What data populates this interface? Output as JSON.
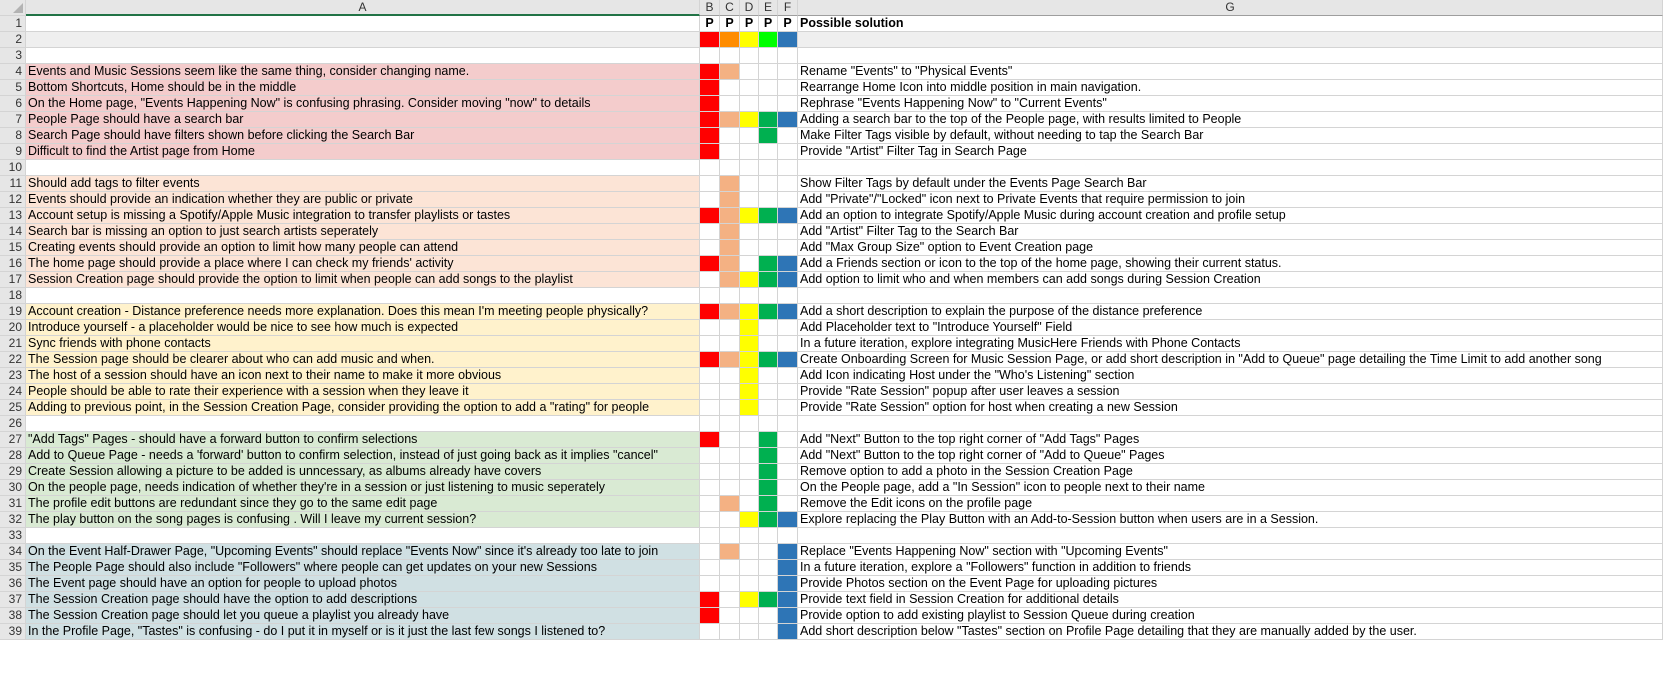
{
  "colors": {
    "red": "#ff0000",
    "orange": "#ff8c00",
    "salmon": "#f4b183",
    "yellow": "#ffff00",
    "lightgreen": "#00ff00",
    "green": "#00b050",
    "blue": "#2e75b6",
    "pink": "#f4cccc",
    "peach": "#fce4d6",
    "cream": "#fff2cc",
    "mint": "#d9ead3",
    "lightblue": "#d0e0e3",
    "gray": "#efefef"
  },
  "column_headers": [
    "A",
    "B",
    "C",
    "D",
    "E",
    "F",
    "G"
  ],
  "rows": [
    {
      "n": "1",
      "a": "",
      "bg": "",
      "m": [
        "",
        "",
        "",
        "",
        ""
      ],
      "p": [
        "P",
        "P",
        "P",
        "P",
        "P"
      ],
      "g": "Possible solution",
      "gbold": true
    },
    {
      "n": "2",
      "a": "",
      "bg": "gray",
      "m": [
        "red",
        "orange",
        "yellow",
        "lightgreen",
        "blue"
      ],
      "p": [
        "",
        "",
        "",
        "",
        ""
      ],
      "g": "",
      "gbg": "gray"
    },
    {
      "n": "3",
      "a": "",
      "bg": "",
      "m": [
        "",
        "",
        "",
        "",
        ""
      ],
      "p": [
        "",
        "",
        "",
        "",
        ""
      ],
      "g": ""
    },
    {
      "n": "4",
      "a": "Events and Music Sessions seem like the same thing, consider changing name.",
      "bg": "pink",
      "m": [
        "red",
        "salmon",
        "",
        "",
        ""
      ],
      "p": [
        "",
        "",
        "",
        "",
        ""
      ],
      "g": "Rename \"Events\" to \"Physical Events\""
    },
    {
      "n": "5",
      "a": "Bottom Shortcuts, Home should be in the middle",
      "bg": "pink",
      "m": [
        "red",
        "",
        "",
        "",
        ""
      ],
      "p": [
        "",
        "",
        "",
        "",
        ""
      ],
      "g": "Rearrange Home Icon into middle position in main navigation."
    },
    {
      "n": "6",
      "a": "On the Home page, \"Events Happening Now\" is confusing phrasing. Consider moving \"now\" to details",
      "bg": "pink",
      "m": [
        "red",
        "",
        "",
        "",
        ""
      ],
      "p": [
        "",
        "",
        "",
        "",
        ""
      ],
      "g": "Rephrase \"Events Happening Now\" to \"Current Events\""
    },
    {
      "n": "7",
      "a": "People Page should have a search bar",
      "bg": "pink",
      "m": [
        "red",
        "salmon",
        "yellow",
        "green",
        "blue"
      ],
      "p": [
        "",
        "",
        "",
        "",
        ""
      ],
      "g": "Adding a search bar to the top of the People page, with results limited to People"
    },
    {
      "n": "8",
      "a": "Search Page should have filters shown before clicking the Search Bar",
      "bg": "pink",
      "m": [
        "red",
        "",
        "",
        "green",
        ""
      ],
      "p": [
        "",
        "",
        "",
        "",
        ""
      ],
      "g": "Make Filter Tags visible by default, without needing to tap the Search Bar"
    },
    {
      "n": "9",
      "a": "Difficult to find the Artist page from Home",
      "bg": "pink",
      "m": [
        "red",
        "",
        "",
        "",
        ""
      ],
      "p": [
        "",
        "",
        "",
        "",
        ""
      ],
      "g": "Provide \"Artist\" Filter Tag in Search Page"
    },
    {
      "n": "10",
      "a": "",
      "bg": "",
      "m": [
        "",
        "",
        "",
        "",
        ""
      ],
      "p": [
        "",
        "",
        "",
        "",
        ""
      ],
      "g": ""
    },
    {
      "n": "11",
      "a": "Should add tags to filter events",
      "bg": "peach",
      "m": [
        "",
        "salmon",
        "",
        "",
        ""
      ],
      "p": [
        "",
        "",
        "",
        "",
        ""
      ],
      "g": "Show Filter Tags by default under the Events Page Search Bar"
    },
    {
      "n": "12",
      "a": "Events should provide an indication whether they are public or private",
      "bg": "peach",
      "m": [
        "",
        "salmon",
        "",
        "",
        ""
      ],
      "p": [
        "",
        "",
        "",
        "",
        ""
      ],
      "g": "Add \"Private\"/\"Locked\" icon next to Private Events that require permission to join"
    },
    {
      "n": "13",
      "a": "Account setup is missing a Spotify/Apple Music integration to transfer playlists or tastes",
      "bg": "peach",
      "m": [
        "red",
        "salmon",
        "yellow",
        "green",
        "blue"
      ],
      "p": [
        "",
        "",
        "",
        "",
        ""
      ],
      "g": "Add an option to integrate Spotify/Apple Music during account creation and profile setup"
    },
    {
      "n": "14",
      "a": "Search bar is missing an option to just search artists seperately",
      "bg": "peach",
      "m": [
        "",
        "salmon",
        "",
        "",
        ""
      ],
      "p": [
        "",
        "",
        "",
        "",
        ""
      ],
      "g": "Add \"Artist\" Filter Tag to the Search Bar"
    },
    {
      "n": "15",
      "a": "Creating events should provide an option to limit how many people can attend",
      "bg": "peach",
      "m": [
        "",
        "salmon",
        "",
        "",
        ""
      ],
      "p": [
        "",
        "",
        "",
        "",
        ""
      ],
      "g": "Add \"Max Group Size\" option to Event Creation page"
    },
    {
      "n": "16",
      "a": "The home page should provide a place where I can check my friends' activity",
      "bg": "peach",
      "m": [
        "red",
        "salmon",
        "",
        "green",
        "blue"
      ],
      "p": [
        "",
        "",
        "",
        "",
        ""
      ],
      "g": "Add a Friends section or icon to the top of the home page, showing their current status."
    },
    {
      "n": "17",
      "a": "Session Creation page should provide the option to limit when people can add songs to the playlist",
      "bg": "peach",
      "m": [
        "",
        "salmon",
        "yellow",
        "green",
        "blue"
      ],
      "p": [
        "",
        "",
        "",
        "",
        ""
      ],
      "g": "Add option to limit who and when members can add songs during Session Creation"
    },
    {
      "n": "18",
      "a": "",
      "bg": "",
      "m": [
        "",
        "",
        "",
        "",
        ""
      ],
      "p": [
        "",
        "",
        "",
        "",
        ""
      ],
      "g": ""
    },
    {
      "n": "19",
      "a": "Account creation - Distance preference needs more explanation. Does this mean I'm meeting people physically?",
      "bg": "cream",
      "m": [
        "red",
        "salmon",
        "yellow",
        "green",
        "blue"
      ],
      "p": [
        "",
        "",
        "",
        "",
        ""
      ],
      "g": "Add a short description to explain the purpose of the distance preference"
    },
    {
      "n": "20",
      "a": "Introduce yourself - a placeholder would be nice to see how much is expected",
      "bg": "cream",
      "m": [
        "",
        "",
        "yellow",
        "",
        ""
      ],
      "p": [
        "",
        "",
        "",
        "",
        ""
      ],
      "g": "Add Placeholder text to \"Introduce Yourself\" Field"
    },
    {
      "n": "21",
      "a": "Sync friends with phone contacts",
      "bg": "cream",
      "m": [
        "",
        "",
        "yellow",
        "",
        ""
      ],
      "p": [
        "",
        "",
        "",
        "",
        ""
      ],
      "g": "In a future iteration, explore integrating MusicHere Friends with Phone Contacts"
    },
    {
      "n": "22",
      "a": "The Session page should be clearer about who can add music and when.",
      "bg": "cream",
      "m": [
        "red",
        "salmon",
        "yellow",
        "green",
        "blue"
      ],
      "p": [
        "",
        "",
        "",
        "",
        ""
      ],
      "g": "Create Onboarding Screen for Music Session Page, or add short description in \"Add to Queue\" page detailing the Time Limit to add another song"
    },
    {
      "n": "23",
      "a": "The host of a session should have an icon next to their name to make it more obvious",
      "bg": "cream",
      "m": [
        "",
        "",
        "yellow",
        "",
        ""
      ],
      "p": [
        "",
        "",
        "",
        "",
        ""
      ],
      "g": "Add Icon indicating Host under the \"Who's Listening\" section"
    },
    {
      "n": "24",
      "a": "People should be able to rate their experience with a session when they leave it",
      "bg": "cream",
      "m": [
        "",
        "",
        "yellow",
        "",
        ""
      ],
      "p": [
        "",
        "",
        "",
        "",
        ""
      ],
      "g": "Provide \"Rate Session\" popup after user leaves a session"
    },
    {
      "n": "25",
      "a": "Adding to previous point, in the Session Creation Page, consider providing the option to add a \"rating\" for people",
      "bg": "cream",
      "m": [
        "",
        "",
        "yellow",
        "",
        ""
      ],
      "p": [
        "",
        "",
        "",
        "",
        ""
      ],
      "g": "Provide \"Rate Session\" option for host when creating a new Session"
    },
    {
      "n": "26",
      "a": "",
      "bg": "",
      "m": [
        "",
        "",
        "",
        "",
        ""
      ],
      "p": [
        "",
        "",
        "",
        "",
        ""
      ],
      "g": ""
    },
    {
      "n": "27",
      "a": "\"Add Tags\" Pages - should have a forward button to confirm selections",
      "bg": "mint",
      "m": [
        "red",
        "",
        "",
        "green",
        ""
      ],
      "p": [
        "",
        "",
        "",
        "",
        ""
      ],
      "g": "Add \"Next\" Button to the top right corner of \"Add Tags\" Pages"
    },
    {
      "n": "28",
      "a": "Add to Queue Page - needs a 'forward' button to confirm selection, instead of just going back as it implies \"cancel\"",
      "bg": "mint",
      "m": [
        "",
        "",
        "",
        "green",
        ""
      ],
      "p": [
        "",
        "",
        "",
        "",
        ""
      ],
      "g": "Add \"Next\" Button to the top right corner of \"Add to Queue\" Pages"
    },
    {
      "n": "29",
      "a": "Create Session allowing a picture to be added is unncessary, as albums already have covers",
      "bg": "mint",
      "m": [
        "",
        "",
        "",
        "green",
        ""
      ],
      "p": [
        "",
        "",
        "",
        "",
        ""
      ],
      "g": "Remove option to add a photo in the Session Creation Page"
    },
    {
      "n": "30",
      "a": "On the people page, needs indication of whether they're in a session or just listening to music seperately",
      "bg": "mint",
      "m": [
        "",
        "",
        "",
        "green",
        ""
      ],
      "p": [
        "",
        "",
        "",
        "",
        ""
      ],
      "g": "On the People page, add a \"In Session\" icon to people next to their name"
    },
    {
      "n": "31",
      "a": "The profile edit buttons are redundant since they go to the same edit page",
      "bg": "mint",
      "m": [
        "",
        "salmon",
        "",
        "green",
        ""
      ],
      "p": [
        "",
        "",
        "",
        "",
        ""
      ],
      "g": "Remove the Edit icons on the profile page"
    },
    {
      "n": "32",
      "a": "The play button on the song pages is confusing . Will I leave my current session?",
      "bg": "mint",
      "m": [
        "",
        "",
        "yellow",
        "green",
        "blue"
      ],
      "p": [
        "",
        "",
        "",
        "",
        ""
      ],
      "g": "Explore replacing the Play Button with an Add-to-Session button when users are in a Session."
    },
    {
      "n": "33",
      "a": "",
      "bg": "",
      "m": [
        "",
        "",
        "",
        "",
        ""
      ],
      "p": [
        "",
        "",
        "",
        "",
        ""
      ],
      "g": ""
    },
    {
      "n": "34",
      "a": "On the Event Half-Drawer Page, \"Upcoming Events\" should replace \"Events Now\" since it's already too late to join",
      "bg": "lightblue",
      "m": [
        "",
        "salmon",
        "",
        "",
        "blue"
      ],
      "p": [
        "",
        "",
        "",
        "",
        ""
      ],
      "g": "Replace \"Events Happening Now\" section with \"Upcoming Events\""
    },
    {
      "n": "35",
      "a": "The People Page should also include \"Followers\" where people can get updates on your new Sessions",
      "bg": "lightblue",
      "m": [
        "",
        "",
        "",
        "",
        "blue"
      ],
      "p": [
        "",
        "",
        "",
        "",
        ""
      ],
      "g": "In a future iteration, explore a \"Followers\" function in addition to friends"
    },
    {
      "n": "36",
      "a": "The Event page should have an option for people to upload photos",
      "bg": "lightblue",
      "m": [
        "",
        "",
        "",
        "",
        "blue"
      ],
      "p": [
        "",
        "",
        "",
        "",
        ""
      ],
      "g": "Provide Photos section on the Event Page for uploading pictures"
    },
    {
      "n": "37",
      "a": "The Session Creation page should have the option to add descriptions",
      "bg": "lightblue",
      "m": [
        "red",
        "",
        "yellow",
        "green",
        "blue"
      ],
      "p": [
        "",
        "",
        "",
        "",
        ""
      ],
      "g": "Provide text field in Session Creation for additional details"
    },
    {
      "n": "38",
      "a": "The Session Creation page should let you queue a playlist you already have",
      "bg": "lightblue",
      "m": [
        "red",
        "",
        "",
        "",
        "blue"
      ],
      "p": [
        "",
        "",
        "",
        "",
        ""
      ],
      "g": "Provide option to add existing playlist to Session Queue during creation"
    },
    {
      "n": "39",
      "a": "In the Profile Page, \"Tastes\" is confusing - do I put it in myself or is it just the last few songs I listened to?",
      "bg": "lightblue",
      "m": [
        "",
        "",
        "",
        "",
        "blue"
      ],
      "p": [
        "",
        "",
        "",
        "",
        ""
      ],
      "g": "Add short description below \"Tastes\" section on Profile Page detailing that they are manually added by the user."
    }
  ]
}
